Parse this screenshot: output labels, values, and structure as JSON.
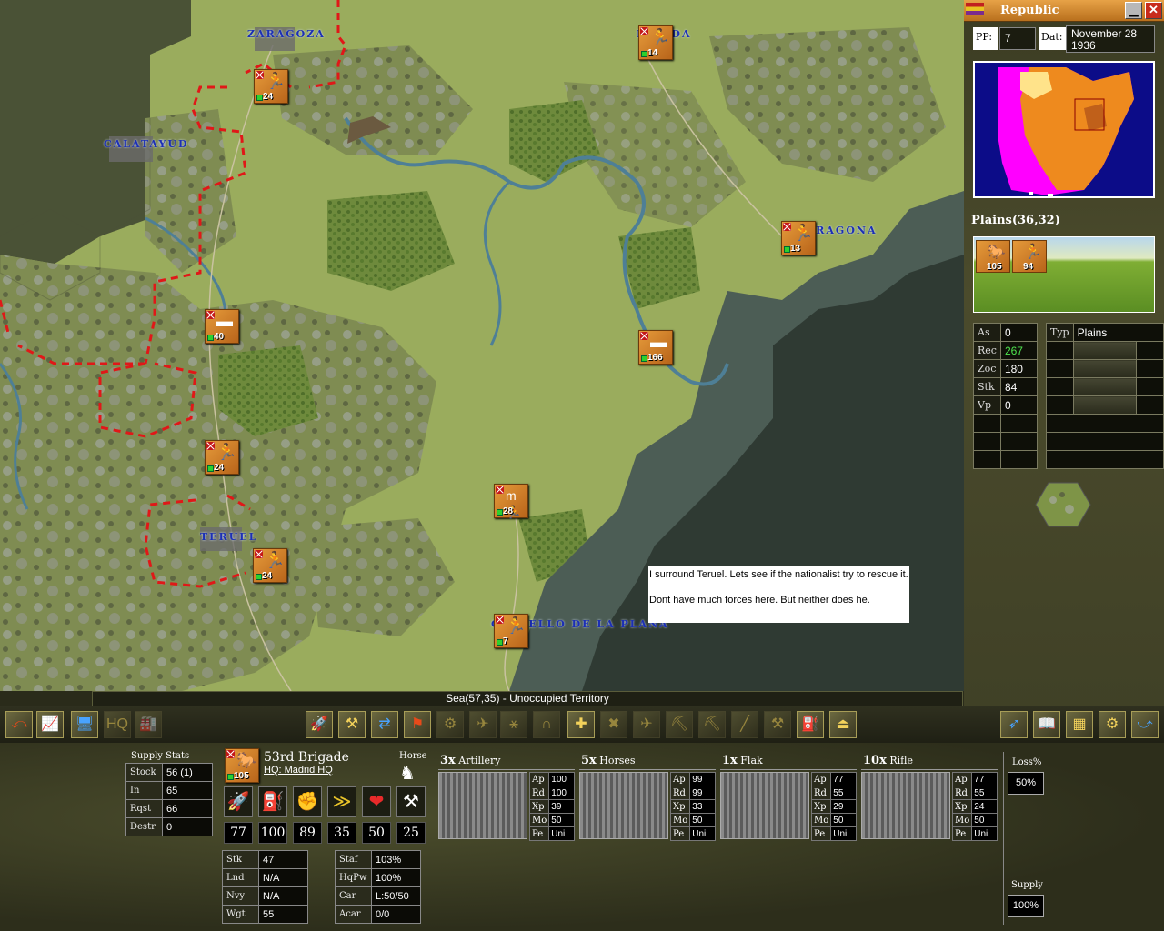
{
  "map": {
    "cities": [
      {
        "id": "zaragoza",
        "label": "ZARAGOZA"
      },
      {
        "id": "lerida",
        "label": "LERIDA"
      },
      {
        "id": "calatayud",
        "label": "CALATAYUD"
      },
      {
        "id": "tarragona",
        "label": "TARRAGONA"
      },
      {
        "id": "teruel",
        "label": "TERUEL"
      },
      {
        "id": "castello",
        "label": "CASTELLO DE LA PLANA"
      }
    ],
    "units": [
      {
        "id": "zaragoza-inf",
        "glyph": "🏃",
        "strength": "24"
      },
      {
        "id": "lerida-inf",
        "glyph": "🏃",
        "strength": "14"
      },
      {
        "id": "tarragona-inf",
        "glyph": "🏃",
        "strength": "13"
      },
      {
        "id": "west-tank",
        "glyph": "▬",
        "strength": "40"
      },
      {
        "id": "coast-tank",
        "glyph": "▬",
        "strength": "166"
      },
      {
        "id": "mid-inf",
        "glyph": "🏃",
        "strength": "24"
      },
      {
        "id": "mtn-inf",
        "glyph": "m🏃",
        "strength": "28"
      },
      {
        "id": "teruel-inf",
        "glyph": "🏃",
        "strength": "24"
      },
      {
        "id": "castello-inf",
        "glyph": "🏃",
        "strength": "7"
      }
    ],
    "note_line1": "I surround Teruel. Lets see if the nationalist try to rescue it.",
    "note_line2": "Dont have much forces here. But neither does he.",
    "status": "Sea(57,35) - Unoccupied Territory"
  },
  "right_panel": {
    "faction": "Republic",
    "pp_label": "PP:",
    "pp_value": "7",
    "date_label": "Dat:",
    "date_value": "November 28 1936",
    "terrain_title": "Plains(36,32)",
    "hex_units": [
      {
        "glyph": "🐎",
        "strength": "105"
      },
      {
        "glyph": "🏃",
        "strength": "94"
      }
    ],
    "stats": [
      {
        "label": "As",
        "value": "0"
      },
      {
        "label": "Rec",
        "value": "267"
      },
      {
        "label": "Zoc",
        "value": "180"
      },
      {
        "label": "Stk",
        "value": "84"
      },
      {
        "label": "Vp",
        "value": "0"
      }
    ],
    "typ_label": "Typ",
    "typ_value": "Plains",
    "rec_color": "#4ee44e"
  },
  "bottom": {
    "supply_title": "Supply Stats",
    "supply": [
      {
        "label": "Stock",
        "value": "56 (1)"
      },
      {
        "label": "In",
        "value": "65"
      },
      {
        "label": "Rqst",
        "value": "66"
      },
      {
        "label": "Destr",
        "value": "0"
      }
    ],
    "unit": {
      "strength": "105",
      "name": "53rd Brigade",
      "hq": "HQ: Madrid HQ",
      "type": "Horse"
    },
    "attrs": [
      {
        "icon": "ammo-icon",
        "glyph": "🚀",
        "value": "77"
      },
      {
        "icon": "fuel-icon",
        "glyph": "⛽",
        "value": "100"
      },
      {
        "icon": "morale-icon",
        "glyph": "✊",
        "value": "89"
      },
      {
        "icon": "experience-icon",
        "glyph": "≫",
        "value": "35"
      },
      {
        "icon": "readiness-icon",
        "glyph": "❤",
        "value": "50"
      },
      {
        "icon": "entrench-icon",
        "glyph": "⚒",
        "value": "25"
      }
    ],
    "misc_left": [
      {
        "label": "Stk",
        "value": "47"
      },
      {
        "label": "Lnd",
        "value": "N/A"
      },
      {
        "label": "Nvy",
        "value": "N/A"
      },
      {
        "label": "Wgt",
        "value": "55"
      }
    ],
    "misc_right": [
      {
        "label": "Staf",
        "value": "103%"
      },
      {
        "label": "HqPw",
        "value": "100%"
      },
      {
        "label": "Car",
        "value": "L:50/50"
      },
      {
        "label": "Acar",
        "value": "0/0"
      }
    ],
    "elements": [
      {
        "count": "3x",
        "name": "Artillery",
        "stats": [
          [
            "Ap",
            "100"
          ],
          [
            "Rd",
            "100"
          ],
          [
            "Xp",
            "39"
          ],
          [
            "Mo",
            "50"
          ],
          [
            "Pe",
            "Uni"
          ]
        ]
      },
      {
        "count": "5x",
        "name": "Horses",
        "stats": [
          [
            "Ap",
            "99"
          ],
          [
            "Rd",
            "99"
          ],
          [
            "Xp",
            "33"
          ],
          [
            "Mo",
            "50"
          ],
          [
            "Pe",
            "Uni"
          ]
        ]
      },
      {
        "count": "1x",
        "name": "Flak",
        "stats": [
          [
            "Ap",
            "77"
          ],
          [
            "Rd",
            "55"
          ],
          [
            "Xp",
            "29"
          ],
          [
            "Mo",
            "50"
          ],
          [
            "Pe",
            "Uni"
          ]
        ]
      },
      {
        "count": "10x",
        "name": "Rifle",
        "stats": [
          [
            "Ap",
            "77"
          ],
          [
            "Rd",
            "55"
          ],
          [
            "Xp",
            "24"
          ],
          [
            "Mo",
            "50"
          ],
          [
            "Pe",
            "Uni"
          ]
        ]
      }
    ],
    "loss_label": "Loss%",
    "loss_value": "50%",
    "supply_label": "Supply",
    "supply_value": "100%"
  },
  "colors": {
    "unit_orange": "#d98a2f",
    "city_label": "#1c2fb5",
    "encircle_red": "#e01818"
  }
}
